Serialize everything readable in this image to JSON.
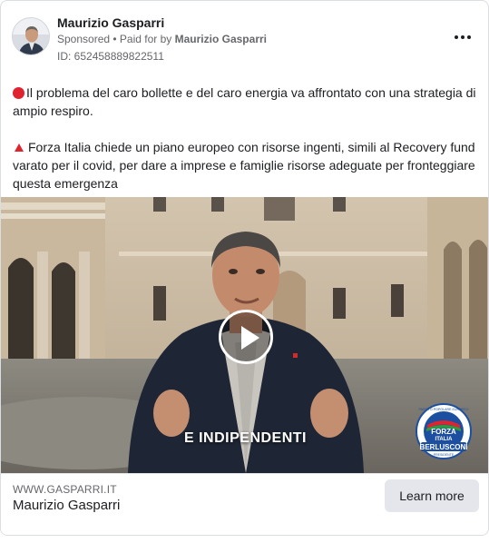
{
  "ad": {
    "page_name": "Maurizio Gasparri",
    "sponsored_label": "Sponsored",
    "separator": " • ",
    "paid_for_prefix": "Paid for by ",
    "paid_for_name": "Maurizio Gasparri",
    "ad_id": "ID: 652458889822511",
    "more_icon": "more-horizontal-icon"
  },
  "body": {
    "paragraph_1": "Il problema del caro bollette e del caro energia va affrontato con una strategia di ampio respiro.",
    "paragraph_2": "Forza Italia chiede un piano europeo con risorse ingenti, simili al Recovery fund varato per il covid, per dare a imprese e famiglie risorse adeguate per fronteggiare questa emergenza",
    "emoji_1": "red-circle-icon",
    "emoji_2": "red-triangle-up-icon"
  },
  "video": {
    "caption": "E INDIPENDENTI",
    "play_icon": "play-icon",
    "logo": {
      "ring_text": "PARTITO POPOLARE EUROPEO",
      "main_text_1": "FORZA",
      "main_text_2": "ITALIA",
      "band_text": "BERLUSCONI",
      "bottom_text": "PRESIDENTE"
    }
  },
  "footer": {
    "domain": "WWW.GASPARRI.IT",
    "title": "Maurizio Gasparri",
    "cta_label": "Learn more"
  },
  "colors": {
    "accent_red": "#e0242f",
    "logo_blue": "#1d4fa0",
    "button_bg": "#e4e6eb",
    "secondary_text": "#65676b"
  }
}
